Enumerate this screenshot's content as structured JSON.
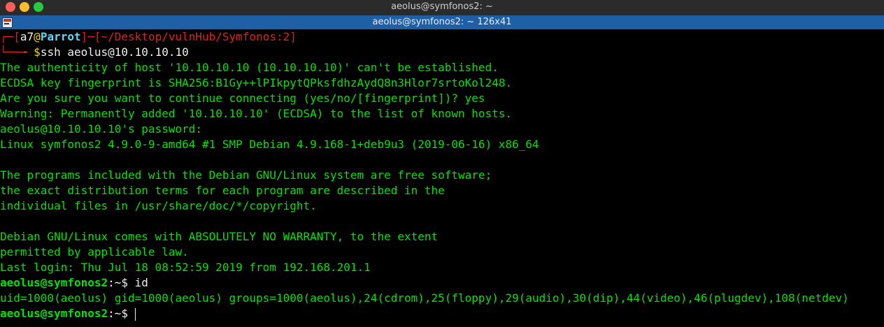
{
  "window": {
    "title": "aeolus@symfonos2: ~",
    "tab_title": "aeolus@symfonos2: ~ 126x41"
  },
  "prompt1": {
    "user": "a7",
    "at": "@",
    "host": "Parrot",
    "path": "~/Desktop/vulnHub/Symfonos:2",
    "dollar": "$",
    "command": "ssh aeolus@10.10.10.10"
  },
  "output": {
    "line1": "The authenticity of host '10.10.10.10 (10.10.10.10)' can't be established.",
    "line2": "ECDSA key fingerprint is SHA256:B1Gy++lPIkpytQPksfdhzAydQ8n3Hlor7srtoKol248.",
    "line3": "Are you sure you want to continue connecting (yes/no/[fingerprint])? yes",
    "line4": "Warning: Permanently added '10.10.10.10' (ECDSA) to the list of known hosts.",
    "line5": "aeolus@10.10.10.10's password:",
    "line6": "Linux symfonos2 4.9.0-9-amd64 #1 SMP Debian 4.9.168-1+deb9u3 (2019-06-16) x86_64",
    "line7": "The programs included with the Debian GNU/Linux system are free software;",
    "line8": "the exact distribution terms for each program are described in the",
    "line9": "individual files in /usr/share/doc/*/copyright.",
    "line10": "Debian GNU/Linux comes with ABSOLUTELY NO WARRANTY, to the extent",
    "line11": "permitted by applicable law.",
    "line12": "Last login: Thu Jul 18 08:52:59 2019 from 192.168.201.1"
  },
  "prompt2": {
    "userhost": "aeolus@symfonos2",
    "sep": ":~$",
    "command": " id"
  },
  "id_output": "uid=1000(aeolus) gid=1000(aeolus) groups=1000(aeolus),24(cdrom),25(floppy),29(audio),30(dip),44(video),46(plugdev),108(netdev)",
  "prompt3": {
    "userhost": "aeolus@symfonos2",
    "sep": ":~$ "
  }
}
